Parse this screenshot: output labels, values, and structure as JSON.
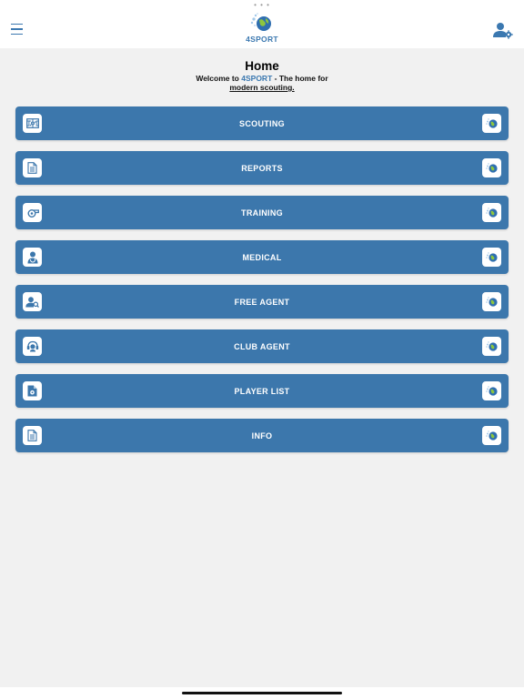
{
  "navbar": {
    "logo_text": "4SPORT"
  },
  "header": {
    "title": "Home",
    "welcome_prefix": "Welcome to ",
    "welcome_brand": "4SPORT",
    "welcome_middle": " - The home for",
    "welcome_link": "modern scouting."
  },
  "menu": {
    "items": [
      {
        "label": "SCOUTING",
        "icon": "scouting-icon"
      },
      {
        "label": "REPORTS",
        "icon": "document-icon"
      },
      {
        "label": "TRAINING",
        "icon": "whistle-icon"
      },
      {
        "label": "MEDICAL",
        "icon": "doctor-icon"
      },
      {
        "label": "FREE AGENT",
        "icon": "user-search-icon"
      },
      {
        "label": "CLUB AGENT",
        "icon": "headset-icon"
      },
      {
        "label": "PLAYER LIST",
        "icon": "file-player-icon"
      },
      {
        "label": "INFO",
        "icon": "document-icon"
      }
    ]
  },
  "colors": {
    "accent": "#3c77ac",
    "background": "#f1f1f1",
    "logo_green": "#8dc63f"
  }
}
